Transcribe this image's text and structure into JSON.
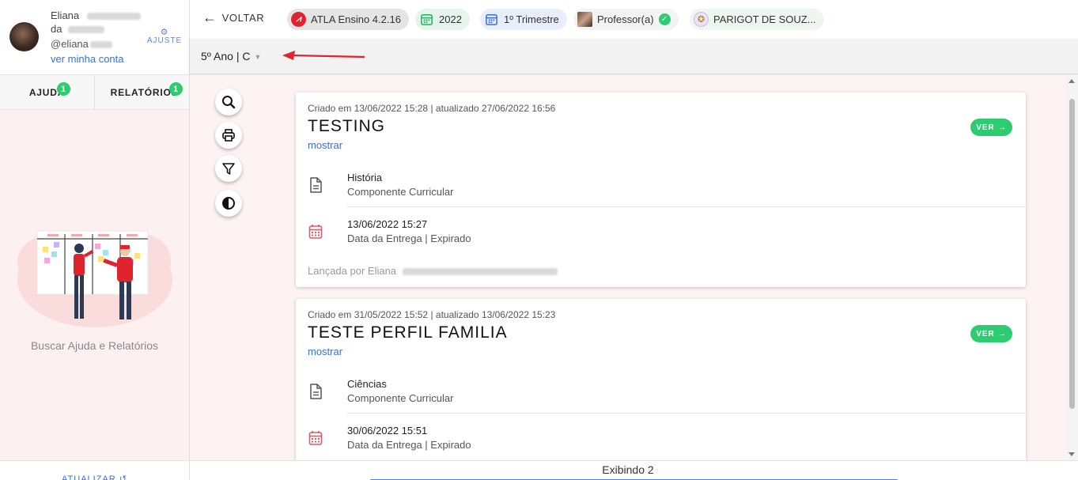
{
  "profile": {
    "first_name": "Eliana",
    "last_name_fragment": "da",
    "username": "@eliana",
    "account_link": "ver minha conta",
    "settings_label": "AJUSTE"
  },
  "sidebar": {
    "tabs": [
      {
        "label": "AJUDA",
        "badge": "1"
      },
      {
        "label": "RELATÓRIOS",
        "badge": "1"
      }
    ],
    "caption": "Buscar Ajuda e Relatórios",
    "footer": "ATUALIZAR ↺"
  },
  "topbar": {
    "back_label": "VOLTAR",
    "chips": [
      {
        "label": "ATLA Ensino 4.2.16",
        "icon": "atla-logo-icon"
      },
      {
        "label": "2022",
        "icon": "calendar-icon"
      },
      {
        "label": "1º Trimestre",
        "icon": "calendar-icon"
      },
      {
        "label": "Professor(a)",
        "icon": "avatar"
      },
      {
        "label": "PARIGOT DE SOUZ...",
        "icon": "school-logo-icon"
      }
    ]
  },
  "class_selector": {
    "value": "5º Ano | C"
  },
  "cards": [
    {
      "meta": "Criado em 13/06/2022 15:28 | atualizado 27/06/2022 16:56",
      "title": "TESTING",
      "show_label": "mostrar",
      "ver_label": "VER",
      "subject": "História",
      "subject_type": "Componente Curricular",
      "due_date": "13/06/2022 15:27",
      "due_status": "Data da Entrega | Expirado",
      "launched_by": "Lançada por Eliana"
    },
    {
      "meta": "Criado em 31/05/2022 15:52 | atualizado 13/06/2022 15:23",
      "title": "TESTE PERFIL FAMILIA",
      "show_label": "mostrar",
      "ver_label": "VER",
      "subject": "Ciências",
      "subject_type": "Componente Curricular",
      "due_date": "30/06/2022 15:51",
      "due_status": "Data da Entrega | Expirado"
    }
  ],
  "footer": {
    "showing": "Exibindo 2"
  },
  "colors": {
    "accent_green": "#2ecc71",
    "link_blue": "#3a6fd8",
    "sidebar_bg": "#fdf0f0",
    "calendar_red": "#e05a6a"
  }
}
